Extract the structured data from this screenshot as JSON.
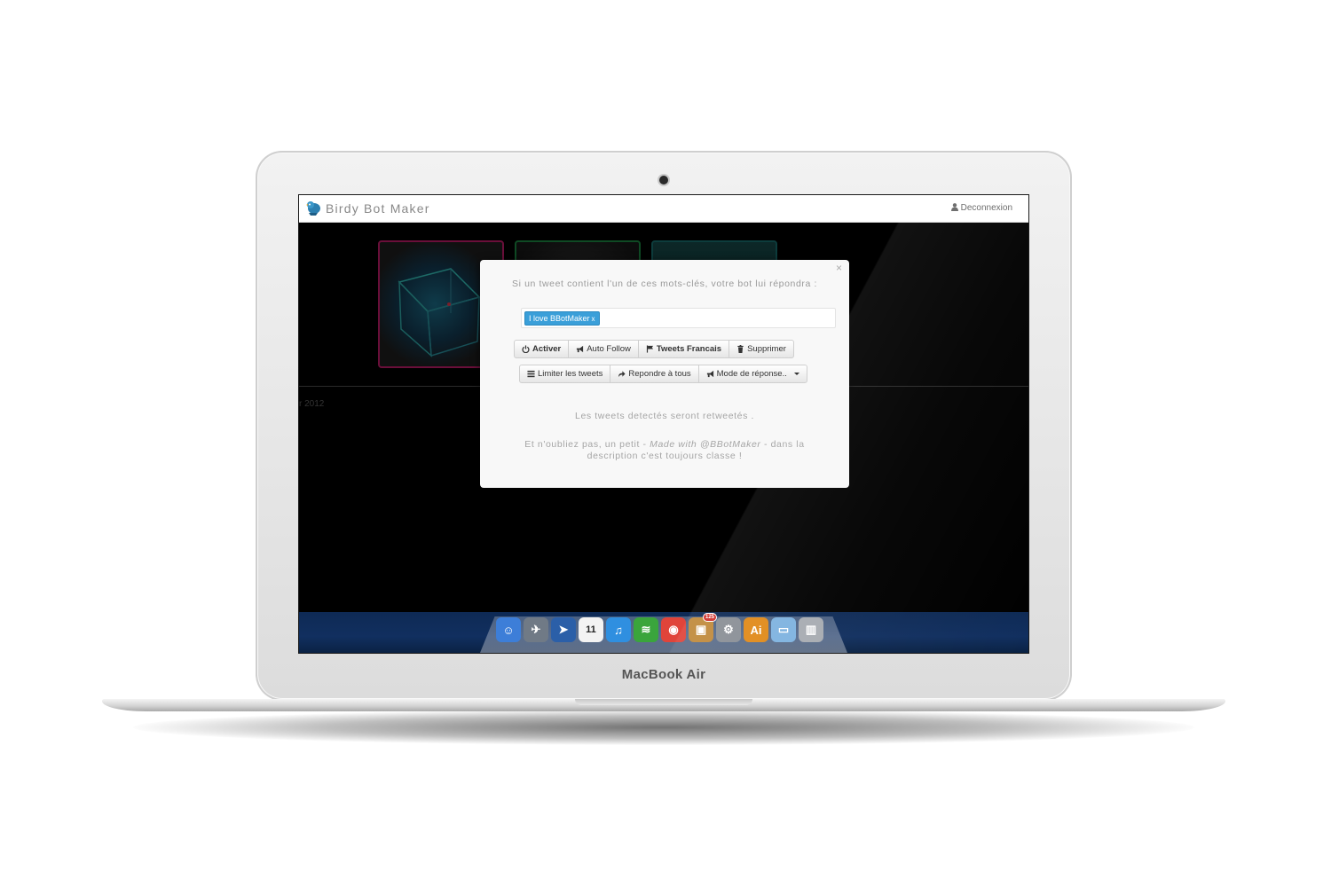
{
  "device": {
    "brand": "MacBook Air"
  },
  "app": {
    "title": "Birdy Bot Maker",
    "logout_label": "Deconnexion"
  },
  "background": {
    "date_fragment": "r 2012"
  },
  "modal": {
    "close_label": "×",
    "prompt": "Si un tweet contient l'un de ces mots-clés, votre bot lui répondra :",
    "tags": [
      {
        "label": "I love BBotMaker",
        "remove": "x"
      }
    ],
    "row1": [
      {
        "label": "Activer",
        "icon": "power-icon",
        "bold": true
      },
      {
        "label": "Auto Follow",
        "icon": "megaphone-icon",
        "bold": false
      },
      {
        "label": "Tweets Francais",
        "icon": "flag-icon",
        "bold": true
      },
      {
        "label": "Supprimer",
        "icon": "trash-icon",
        "bold": false
      }
    ],
    "row2": [
      {
        "label": "Limiter les tweets",
        "icon": "list-icon"
      },
      {
        "label": "Repondre à tous",
        "icon": "share-arrow-icon"
      },
      {
        "label": "Mode de réponse..",
        "icon": "megaphone-icon",
        "dropdown": true
      }
    ],
    "info_retweet": "Les tweets detectés seront retweetés .",
    "info_footer_before": "Et n'oubliez pas, un petit - ",
    "info_footer_emphasis": "Made with @BBotMaker",
    "info_footer_after": " - dans la description c'est toujours classe !"
  },
  "dock": {
    "items": [
      {
        "name": "finder-icon",
        "color": "#3d7ed8",
        "glyph": "☺"
      },
      {
        "name": "launchpad-icon",
        "color": "#707a86",
        "glyph": "✈"
      },
      {
        "name": "cursor-app-icon",
        "color": "#2b5fa8",
        "glyph": "➤"
      },
      {
        "name": "calendar-icon",
        "color": "#f3f3f3",
        "glyph": "11"
      },
      {
        "name": "itunes-icon",
        "color": "#2f8fe0",
        "glyph": "♫"
      },
      {
        "name": "spotify-icon",
        "color": "#3aa53c",
        "glyph": "≋"
      },
      {
        "name": "chrome-icon",
        "color": "#e0443a",
        "glyph": "◉"
      },
      {
        "name": "package-icon",
        "color": "#c08a3c",
        "glyph": "▣",
        "badge": "125"
      },
      {
        "name": "system-prefs-icon",
        "color": "#8a8f96",
        "glyph": "⚙"
      },
      {
        "name": "illustrator-icon",
        "color": "#e08a1a",
        "glyph": "Ai"
      },
      {
        "name": "folder-icon",
        "color": "#7fb3e0",
        "glyph": "▭"
      },
      {
        "name": "trash-can-icon",
        "color": "#a8acb2",
        "glyph": "▥"
      }
    ]
  }
}
